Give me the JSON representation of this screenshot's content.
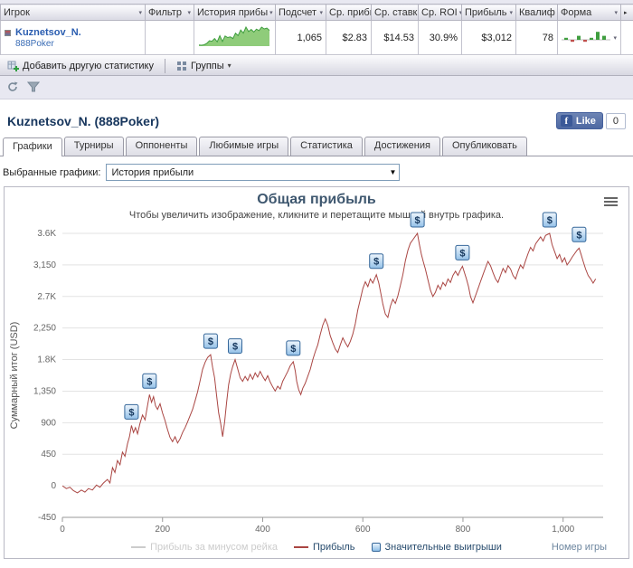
{
  "stats_table": {
    "columns": [
      "Игрок",
      "Фильтр",
      "История прибы",
      "Подсчет",
      "Ср. прибы",
      "Ср. ставк:",
      "Ср. ROI",
      "Прибыль",
      "Квалиф",
      "Форма"
    ],
    "row": {
      "player": "Kuznetsov_N.",
      "site": "888Poker",
      "count": "1,065",
      "avg_profit": "$2.83",
      "avg_stake": "$14.53",
      "avg_roi": "30.9%",
      "profit": "$3,012",
      "qualified": "78",
      "sparkline": [
        0,
        -60,
        40,
        300,
        860,
        740,
        1300,
        630,
        1870,
        700,
        1800,
        1490,
        1630,
        1300,
        2380,
        1900,
        3010,
        2400,
        3600,
        2700,
        3130,
        2610,
        3200,
        2900,
        3600,
        3240,
        3390,
        2950
      ],
      "form_bars": [
        1,
        -1,
        2,
        -1,
        1,
        4,
        2
      ]
    }
  },
  "toolbar": {
    "add_stat_label": "Добавить другую статистику",
    "groups_label": "Группы"
  },
  "player": {
    "title": "Kuznetsov_N. (888Poker)"
  },
  "fb": {
    "like_label": "Like",
    "count": "0"
  },
  "tabs": [
    {
      "label": "Графики",
      "active": true
    },
    {
      "label": "Турниры",
      "active": false
    },
    {
      "label": "Оппоненты",
      "active": false
    },
    {
      "label": "Любимые игры",
      "active": false
    },
    {
      "label": "Статистика",
      "active": false
    },
    {
      "label": "Достижения",
      "active": false
    },
    {
      "label": "Опубликовать",
      "active": false
    }
  ],
  "chart_select": {
    "label": "Выбранные графики:",
    "value": "История прибыли"
  },
  "colors": {
    "profit_line": "#AA4643",
    "rake_line": "#CCCCCC",
    "legend_text": "#274B6D",
    "flag_border": "#35679A",
    "title": "#3E576F"
  },
  "chart_data": {
    "type": "line",
    "title": "Общая прибыль",
    "subtitle": "Чтобы увеличить изображение, кликните и перетащите мышкой внутрь графика.",
    "ylabel": "Суммарный итог (USD)",
    "xlabel": "Номер игры",
    "ylim": [
      -450,
      3600
    ],
    "xlim": [
      0,
      1080
    ],
    "grid": "horizontal",
    "legend_position": "bottom",
    "yticks": [
      {
        "value": -450,
        "label": "-450"
      },
      {
        "value": 0,
        "label": "0"
      },
      {
        "value": 450,
        "label": "450"
      },
      {
        "value": 900,
        "label": "900"
      },
      {
        "value": 1350,
        "label": "1,350"
      },
      {
        "value": 1800,
        "label": "1.8K"
      },
      {
        "value": 2250,
        "label": "2,250"
      },
      {
        "value": 2700,
        "label": "2.7K"
      },
      {
        "value": 3150,
        "label": "3,150"
      },
      {
        "value": 3600,
        "label": "3.6K"
      }
    ],
    "xticks": [
      {
        "value": 0,
        "label": "0"
      },
      {
        "value": 200,
        "label": "200"
      },
      {
        "value": 400,
        "label": "400"
      },
      {
        "value": 600,
        "label": "600"
      },
      {
        "value": 800,
        "label": "800"
      },
      {
        "value": 1000,
        "label": "1,000"
      }
    ],
    "series": [
      {
        "name": "Прибыль за минусом рейка",
        "color": "#CCCCCC",
        "visible": false,
        "points": []
      },
      {
        "name": "Прибыль",
        "color": "#AA4643",
        "visible": true,
        "points": [
          [
            0,
            0
          ],
          [
            8,
            -40
          ],
          [
            15,
            -20
          ],
          [
            22,
            -70
          ],
          [
            30,
            -100
          ],
          [
            38,
            -60
          ],
          [
            45,
            -90
          ],
          [
            52,
            -40
          ],
          [
            60,
            -60
          ],
          [
            68,
            10
          ],
          [
            75,
            -20
          ],
          [
            82,
            40
          ],
          [
            90,
            90
          ],
          [
            95,
            40
          ],
          [
            100,
            260
          ],
          [
            105,
            190
          ],
          [
            110,
            360
          ],
          [
            115,
            300
          ],
          [
            120,
            480
          ],
          [
            125,
            420
          ],
          [
            130,
            600
          ],
          [
            134,
            700
          ],
          [
            138,
            860
          ],
          [
            142,
            760
          ],
          [
            146,
            830
          ],
          [
            150,
            740
          ],
          [
            155,
            890
          ],
          [
            160,
            1010
          ],
          [
            165,
            940
          ],
          [
            170,
            1140
          ],
          [
            174,
            1300
          ],
          [
            178,
            1190
          ],
          [
            182,
            1270
          ],
          [
            186,
            1140
          ],
          [
            190,
            1090
          ],
          [
            195,
            1170
          ],
          [
            200,
            1040
          ],
          [
            205,
            930
          ],
          [
            210,
            800
          ],
          [
            215,
            690
          ],
          [
            220,
            630
          ],
          [
            225,
            700
          ],
          [
            230,
            610
          ],
          [
            235,
            670
          ],
          [
            240,
            760
          ],
          [
            245,
            830
          ],
          [
            250,
            910
          ],
          [
            255,
            1000
          ],
          [
            260,
            1090
          ],
          [
            265,
            1210
          ],
          [
            270,
            1340
          ],
          [
            275,
            1500
          ],
          [
            280,
            1660
          ],
          [
            285,
            1760
          ],
          [
            290,
            1830
          ],
          [
            296,
            1870
          ],
          [
            300,
            1690
          ],
          [
            304,
            1540
          ],
          [
            308,
            1290
          ],
          [
            312,
            1040
          ],
          [
            316,
            890
          ],
          [
            320,
            700
          ],
          [
            324,
            910
          ],
          [
            328,
            1190
          ],
          [
            332,
            1440
          ],
          [
            336,
            1590
          ],
          [
            340,
            1700
          ],
          [
            345,
            1800
          ],
          [
            350,
            1670
          ],
          [
            355,
            1540
          ],
          [
            360,
            1490
          ],
          [
            365,
            1560
          ],
          [
            370,
            1500
          ],
          [
            375,
            1590
          ],
          [
            380,
            1520
          ],
          [
            385,
            1610
          ],
          [
            390,
            1550
          ],
          [
            395,
            1630
          ],
          [
            400,
            1560
          ],
          [
            405,
            1500
          ],
          [
            410,
            1570
          ],
          [
            415,
            1480
          ],
          [
            420,
            1410
          ],
          [
            425,
            1350
          ],
          [
            430,
            1420
          ],
          [
            435,
            1380
          ],
          [
            440,
            1490
          ],
          [
            445,
            1560
          ],
          [
            450,
            1630
          ],
          [
            455,
            1710
          ],
          [
            461,
            1770
          ],
          [
            465,
            1640
          ],
          [
            468,
            1490
          ],
          [
            472,
            1370
          ],
          [
            476,
            1300
          ],
          [
            480,
            1390
          ],
          [
            485,
            1460
          ],
          [
            490,
            1560
          ],
          [
            495,
            1660
          ],
          [
            500,
            1800
          ],
          [
            505,
            1910
          ],
          [
            510,
            2010
          ],
          [
            515,
            2160
          ],
          [
            520,
            2290
          ],
          [
            525,
            2380
          ],
          [
            530,
            2290
          ],
          [
            535,
            2140
          ],
          [
            540,
            2040
          ],
          [
            545,
            1950
          ],
          [
            550,
            1900
          ],
          [
            555,
            2010
          ],
          [
            560,
            2110
          ],
          [
            565,
            2040
          ],
          [
            570,
            1980
          ],
          [
            575,
            2060
          ],
          [
            580,
            2160
          ],
          [
            585,
            2310
          ],
          [
            590,
            2510
          ],
          [
            595,
            2660
          ],
          [
            600,
            2810
          ],
          [
            605,
            2910
          ],
          [
            610,
            2840
          ],
          [
            615,
            2950
          ],
          [
            620,
            2890
          ],
          [
            627,
            3010
          ],
          [
            632,
            2890
          ],
          [
            636,
            2740
          ],
          [
            640,
            2590
          ],
          [
            645,
            2450
          ],
          [
            650,
            2400
          ],
          [
            655,
            2560
          ],
          [
            660,
            2660
          ],
          [
            665,
            2600
          ],
          [
            670,
            2710
          ],
          [
            675,
            2860
          ],
          [
            680,
            3010
          ],
          [
            685,
            3210
          ],
          [
            690,
            3360
          ],
          [
            695,
            3460
          ],
          [
            700,
            3510
          ],
          [
            705,
            3560
          ],
          [
            709,
            3600
          ],
          [
            713,
            3440
          ],
          [
            717,
            3300
          ],
          [
            721,
            3190
          ],
          [
            725,
            3090
          ],
          [
            730,
            2940
          ],
          [
            735,
            2790
          ],
          [
            740,
            2700
          ],
          [
            745,
            2760
          ],
          [
            750,
            2860
          ],
          [
            755,
            2800
          ],
          [
            760,
            2900
          ],
          [
            765,
            2850
          ],
          [
            770,
            2950
          ],
          [
            775,
            2900
          ],
          [
            780,
            3000
          ],
          [
            785,
            3060
          ],
          [
            790,
            3000
          ],
          [
            795,
            3080
          ],
          [
            799,
            3130
          ],
          [
            803,
            3040
          ],
          [
            807,
            2950
          ],
          [
            811,
            2840
          ],
          [
            815,
            2700
          ],
          [
            820,
            2610
          ],
          [
            825,
            2710
          ],
          [
            830,
            2810
          ],
          [
            835,
            2910
          ],
          [
            840,
            3010
          ],
          [
            845,
            3110
          ],
          [
            850,
            3200
          ],
          [
            855,
            3140
          ],
          [
            860,
            3040
          ],
          [
            865,
            2950
          ],
          [
            870,
            2900
          ],
          [
            875,
            3000
          ],
          [
            880,
            3100
          ],
          [
            885,
            3040
          ],
          [
            890,
            3140
          ],
          [
            895,
            3090
          ],
          [
            900,
            3000
          ],
          [
            905,
            2950
          ],
          [
            910,
            3060
          ],
          [
            915,
            3150
          ],
          [
            920,
            3100
          ],
          [
            925,
            3210
          ],
          [
            930,
            3310
          ],
          [
            935,
            3400
          ],
          [
            940,
            3350
          ],
          [
            945,
            3450
          ],
          [
            950,
            3500
          ],
          [
            955,
            3550
          ],
          [
            960,
            3490
          ],
          [
            965,
            3570
          ],
          [
            973,
            3600
          ],
          [
            978,
            3440
          ],
          [
            983,
            3340
          ],
          [
            988,
            3240
          ],
          [
            993,
            3300
          ],
          [
            998,
            3190
          ],
          [
            1003,
            3250
          ],
          [
            1008,
            3150
          ],
          [
            1013,
            3200
          ],
          [
            1018,
            3260
          ],
          [
            1023,
            3310
          ],
          [
            1028,
            3360
          ],
          [
            1032,
            3390
          ],
          [
            1036,
            3300
          ],
          [
            1040,
            3200
          ],
          [
            1045,
            3090
          ],
          [
            1050,
            3000
          ],
          [
            1055,
            2950
          ],
          [
            1060,
            2890
          ],
          [
            1065,
            2950
          ]
        ]
      }
    ],
    "marker_symbol": "$",
    "marker_series_name": "Значительные выигрыши",
    "markers": [
      {
        "x": 138,
        "y": 860
      },
      {
        "x": 174,
        "y": 1300
      },
      {
        "x": 296,
        "y": 1870
      },
      {
        "x": 345,
        "y": 1800
      },
      {
        "x": 461,
        "y": 1770
      },
      {
        "x": 627,
        "y": 3010
      },
      {
        "x": 709,
        "y": 3600
      },
      {
        "x": 799,
        "y": 3130
      },
      {
        "x": 973,
        "y": 3600
      },
      {
        "x": 1032,
        "y": 3390
      }
    ],
    "legend": [
      {
        "label": "Прибыль за минусом рейка",
        "type": "line",
        "color": "#CCCCCC",
        "disabled": true
      },
      {
        "label": "Прибыль",
        "type": "line",
        "color": "#AA4643",
        "disabled": false
      },
      {
        "label": "Значительные выигрыши",
        "type": "square",
        "color": "#5B9BD5",
        "disabled": false
      }
    ]
  }
}
